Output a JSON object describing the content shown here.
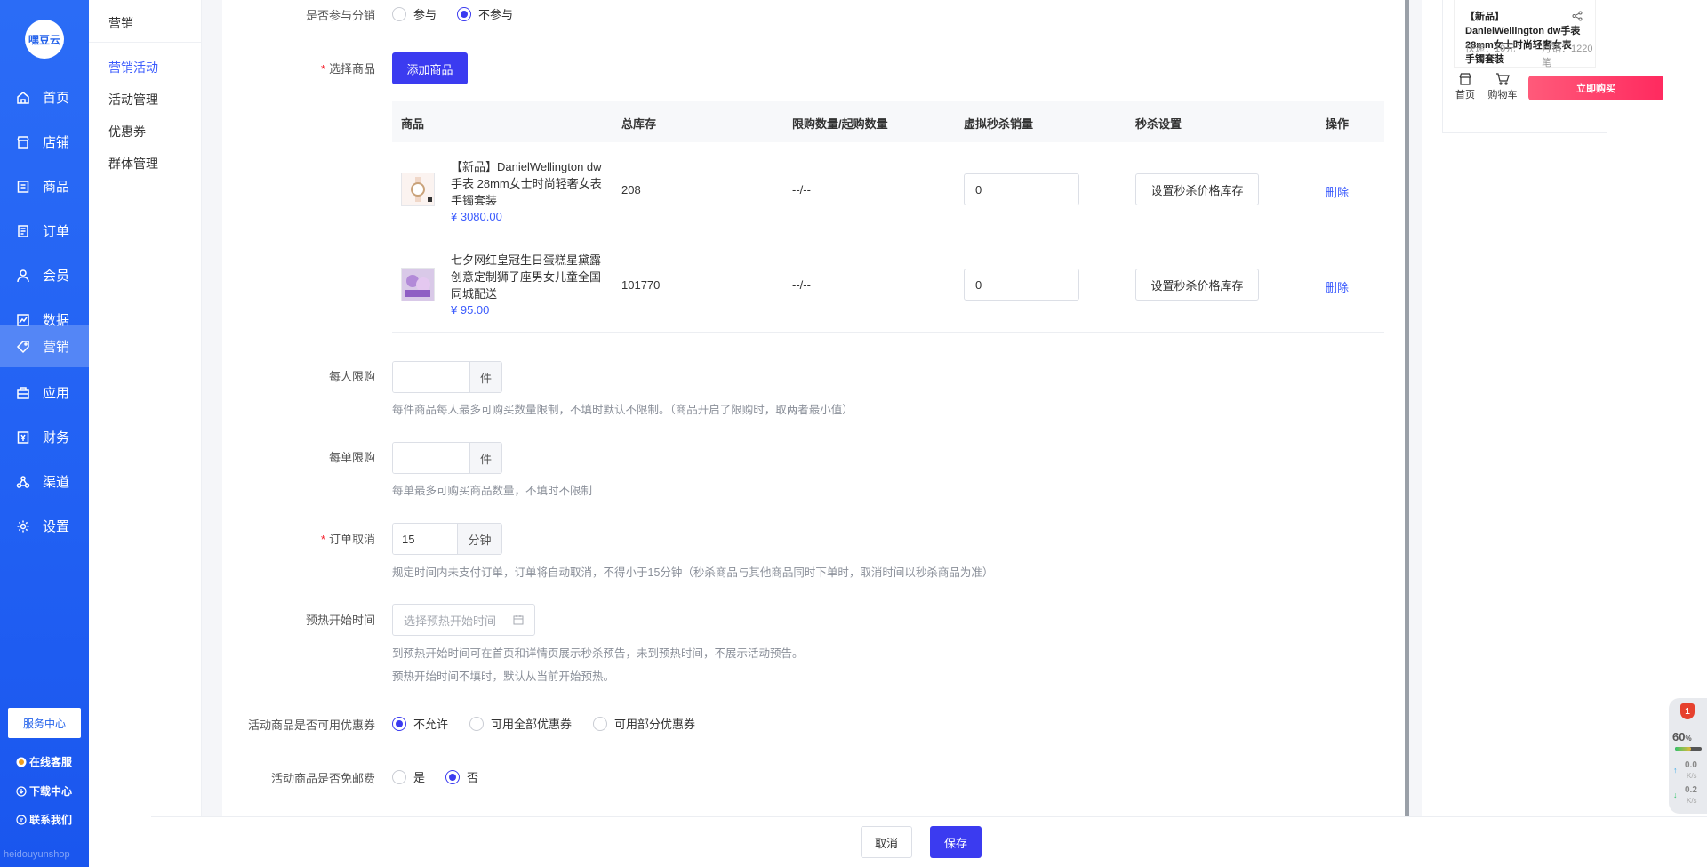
{
  "sidebar": {
    "logo_text": "嘿豆云",
    "items": [
      {
        "label": "首页",
        "icon": "home-icon"
      },
      {
        "label": "店铺",
        "icon": "store-icon"
      },
      {
        "label": "商品",
        "icon": "goods-icon"
      },
      {
        "label": "订单",
        "icon": "order-icon"
      },
      {
        "label": "会员",
        "icon": "user-icon"
      },
      {
        "label": "数据",
        "icon": "chart-icon"
      },
      {
        "label": "营销",
        "icon": "tag-icon",
        "active": true
      },
      {
        "label": "应用",
        "icon": "app-icon"
      },
      {
        "label": "财务",
        "icon": "finance-icon"
      },
      {
        "label": "渠道",
        "icon": "channel-icon"
      },
      {
        "label": "设置",
        "icon": "gear-icon"
      }
    ],
    "service_center": "服务中心",
    "links": [
      "在线客服",
      "下载中心",
      "联系我们"
    ],
    "watermark": "heidouyunshop"
  },
  "subnav": {
    "title": "营销",
    "items": [
      {
        "label": "营销活动",
        "active": true
      },
      {
        "label": "活动管理"
      },
      {
        "label": "优惠券"
      },
      {
        "label": "群体管理"
      }
    ]
  },
  "form": {
    "distribution": {
      "label": "是否参与分销",
      "options": [
        "参与",
        "不参与"
      ],
      "selected": "不参与"
    },
    "select_goods": {
      "label": "选择商品",
      "button": "添加商品"
    },
    "table": {
      "headers": [
        "商品",
        "总库存",
        "限购数量/起购数量",
        "虚拟秒杀销量",
        "秒杀设置",
        "操作"
      ],
      "rows": [
        {
          "name": "【新品】DanielWellington dw手表 28mm女士时尚轻奢女表手镯套装",
          "price": "¥ 3080.00",
          "stock": "208",
          "limit": "--/--",
          "virtual_sales": "0",
          "setting": "设置秒杀价格库存",
          "action": "删除"
        },
        {
          "name": "七夕网红皇冠生日蛋糕星黛露创意定制狮子座男女儿童全国同城配送",
          "price": "¥ 95.00",
          "stock": "101770",
          "limit": "--/--",
          "virtual_sales": "0",
          "setting": "设置秒杀价格库存",
          "action": "删除"
        }
      ]
    },
    "per_person": {
      "label": "每人限购",
      "unit": "件",
      "hint": "每件商品每人最多可购买数量限制，不填时默认不限制。（商品开启了限购时，取两者最小值）"
    },
    "per_order": {
      "label": "每单限购",
      "unit": "件",
      "hint": "每单最多可购买商品数量，不填时不限制"
    },
    "order_cancel": {
      "label": "订单取消",
      "value": "15",
      "unit": "分钟",
      "hint": "规定时间内未支付订单，订单将自动取消，不得小于15分钟（秒杀商品与其他商品同时下单时，取消时间以秒杀商品为准）"
    },
    "preheat": {
      "label": "预热开始时间",
      "placeholder": "选择预热开始时间",
      "hint1": "到预热开始时间可在首页和详情页展示秒杀预告，未到预热时间，不展示活动预告。",
      "hint2": "预热开始时间不填时，默认从当前开始预热。"
    },
    "coupon": {
      "label": "活动商品是否可用优惠券",
      "options": [
        "不允许",
        "可用全部优惠券",
        "可用部分优惠券"
      ],
      "selected": "不允许"
    },
    "free_shipping": {
      "label": "活动商品是否免邮费",
      "options": [
        "是",
        "否"
      ],
      "selected": "否"
    }
  },
  "footer": {
    "cancel": "取消",
    "save": "保存"
  },
  "preview": {
    "title": "【新品】DanielWellington dw手表28mm女士时尚轻奢女表手镯套装",
    "shipping": "快递：10元",
    "monthly_sales": "月销：1220笔",
    "nav": [
      "首页",
      "购物车"
    ],
    "buy": "立即购买"
  },
  "speed_widget": {
    "badge": "1",
    "percent": "60",
    "percent_unit": "%",
    "up": "0.0",
    "down": "0.2",
    "unit": "K/s",
    "usage_fraction": 0.6
  },
  "colors": {
    "primary": "#3b3bf0",
    "nav_bg": "#2563eb",
    "link": "#3b5bfd",
    "danger": "#f5222d",
    "buy": "#ff2a5f"
  }
}
